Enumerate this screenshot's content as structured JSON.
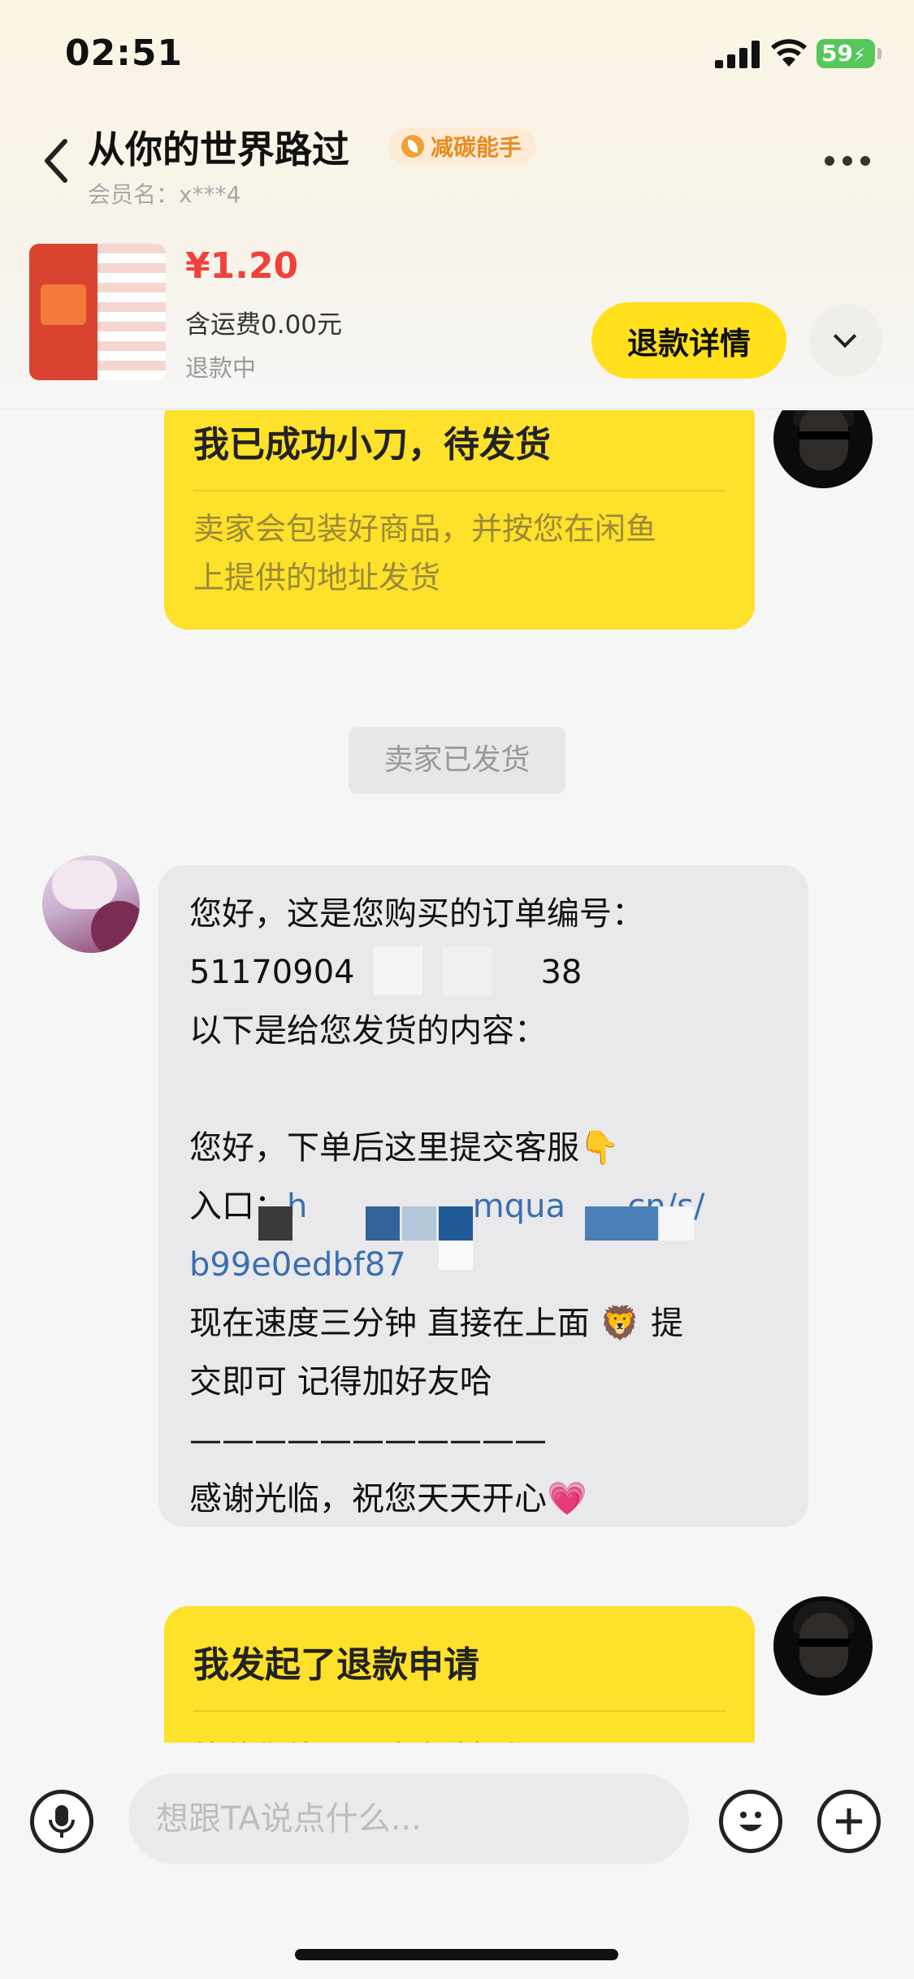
{
  "status_bar": {
    "time": "02:51",
    "battery": "59"
  },
  "header": {
    "title": "从你的世界路过",
    "badge": "减碳能手",
    "member": "会员名：x***4"
  },
  "product": {
    "price": "¥1.20",
    "shipping": "含运费0.00元",
    "state": "退款中",
    "refund_button": "退款详情"
  },
  "messages": {
    "card1": {
      "title": "我已成功小刀，待发货",
      "body_line1": "卖家会包装好商品，并按您在闲鱼",
      "body_line2": "上提供的地址发货"
    },
    "system": "卖家已发货",
    "seller": {
      "line1": "您好，这是您购买的订单编号：",
      "line2": "51170904                  38",
      "line3": "以下是给您发货的内容：",
      "line4": "",
      "line5": "您好，下单后这里提交客服👇",
      "line6a": "入口：",
      "line6b": "h                mqua     .cn/s/",
      "line7": "b99e0edbf87",
      "line8": "现在速度三分钟 直接在上面 🦁 提",
      "line9": "交即可 记得加好友哈",
      "line10": "———————————",
      "line11": "感谢光临，祝您天天开心💗"
    },
    "card2": {
      "title": "我发起了退款申请",
      "body_line1": "等待你处理，请确认操作"
    }
  },
  "composer": {
    "placeholder": "想跟TA说点什么..."
  },
  "colors": {
    "accent_yellow": "#fde12a",
    "price_red": "#f0413b",
    "link_blue": "#3b6fb0"
  }
}
